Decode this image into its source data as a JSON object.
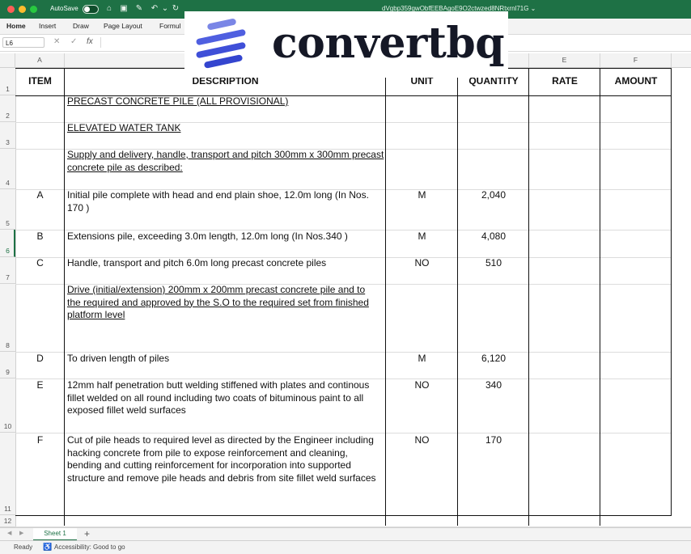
{
  "titlebar": {
    "autosave_label": "AutoSave",
    "file_name": "dVgbp359gwObfEEBAgoE9O2ctwzed8NRtxrnl71G ⌄",
    "accent_color": "#1e7145"
  },
  "ribbon": {
    "tabs": [
      "Home",
      "Insert",
      "Draw",
      "Page Layout",
      "Formul"
    ]
  },
  "formula_bar": {
    "name_box": "L6",
    "fx_label": "fx"
  },
  "watermark": {
    "text": "convertbq"
  },
  "grid": {
    "column_headers": [
      "A",
      "",
      "",
      "",
      "E",
      "F"
    ],
    "row_numbers": [
      "1",
      "2",
      "3",
      "4",
      "5",
      "6",
      "7",
      "8",
      "9",
      "10",
      "11",
      "12"
    ],
    "header_row": {
      "item": "ITEM",
      "description": "DESCRIPTION",
      "unit": "UNIT",
      "quantity": "QUANTITY",
      "rate": "RATE",
      "amount": "AMOUNT"
    },
    "rows": [
      {
        "item": "",
        "description": "PRECAST CONCRETE PILE (ALL PROVISIONAL)",
        "unit": "",
        "quantity": ""
      },
      {
        "item": "",
        "description": "ELEVATED WATER TANK",
        "unit": "",
        "quantity": ""
      },
      {
        "item": "",
        "description": "Supply and delivery, handle, transport and pitch 300mm x 300mm precast concrete pile as described:",
        "unit": "",
        "quantity": ""
      },
      {
        "item": "A",
        "description": "Initial pile complete with head and end plain shoe, 12.0m long (In Nos. 170 )",
        "unit": "M",
        "quantity": "2,040"
      },
      {
        "item": "B",
        "description": "Extensions pile, exceeding 3.0m length, 12.0m long (In Nos.340 )",
        "unit": "M",
        "quantity": "4,080"
      },
      {
        "item": "C",
        "description": "Handle, transport and pitch 6.0m long precast concrete piles",
        "unit": "NO",
        "quantity": "510"
      },
      {
        "item": "",
        "description": "Drive (initial/extension) 200mm x 200mm precast concrete pile and to the required and approved by the S.O to the required set from finished platform level",
        "unit": "",
        "quantity": ""
      },
      {
        "item": "D",
        "description": "To driven length of piles",
        "unit": "M",
        "quantity": "6,120"
      },
      {
        "item": "E",
        "description": "12mm half penetration butt welding stiffened with plates and continous fillet welded on all round including two coats of bituminous paint to all exposed fillet weld surfaces",
        "unit": "NO",
        "quantity": "340"
      },
      {
        "item": "F",
        "description": "Cut of pile heads to required level as directed by the Engineer including hacking concrete from pile to expose reinforcement and cleaning, bending and cutting reinforcement for incorporation into supported structure and remove pile heads and debris from site fillet weld surfaces",
        "unit": "NO",
        "quantity": "170"
      }
    ]
  },
  "sheet_tabs": {
    "active": "Sheet 1",
    "add": "+"
  },
  "status": {
    "ready": "Ready",
    "accessibility": "Accessibility: Good to go"
  }
}
